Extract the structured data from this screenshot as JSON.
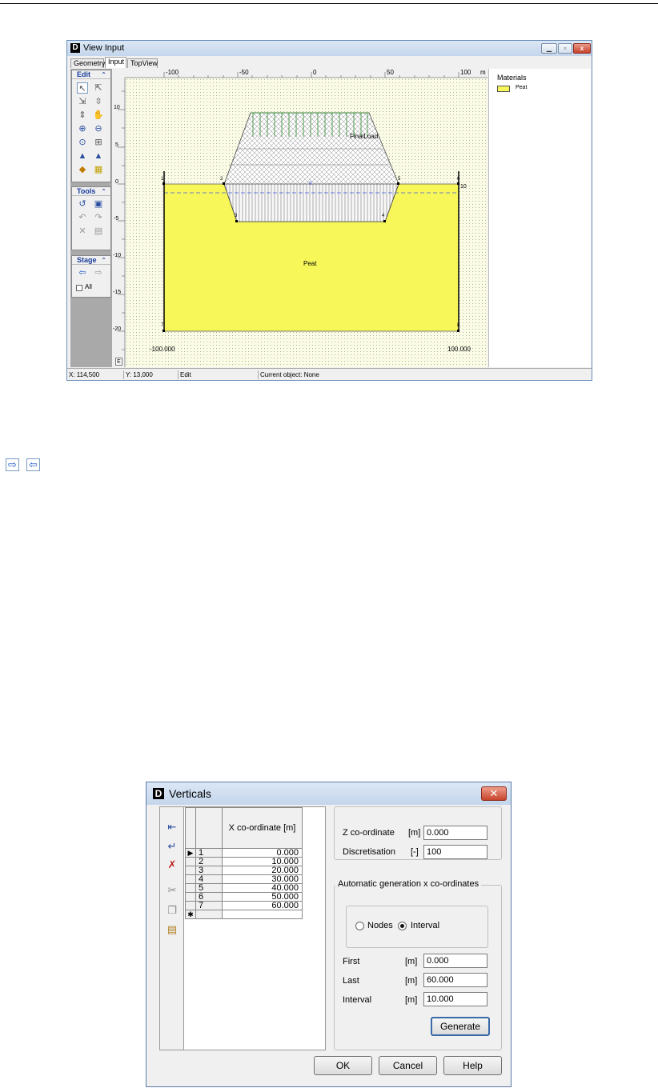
{
  "view_input": {
    "title": "View Input",
    "tabs": [
      "Geometry",
      "Input",
      "TopView"
    ],
    "panels": {
      "edit": "Edit",
      "tools": "Tools",
      "stage": "Stage",
      "all_label": "All"
    },
    "ruler": {
      "x_ticks": [
        "-100",
        "-50",
        "0",
        "50",
        "100",
        "m"
      ],
      "y_ticks": [
        "10",
        "5",
        "0",
        "-5",
        "-10",
        "-15",
        "-20"
      ],
      "corner": "E"
    },
    "drawing": {
      "load_label": "FinalLoad",
      "material_label": "Peat",
      "x_left_label": "-100.000",
      "x_right_label": "100.000",
      "points": [
        "1",
        "2",
        "3",
        "4",
        "5",
        "6",
        "7",
        "8",
        "9",
        "10"
      ]
    },
    "materials": {
      "title": "Materials",
      "items": [
        {
          "name": "Peat",
          "color": "#f7f75a"
        }
      ]
    },
    "status": {
      "x": "X: 114,500",
      "y": "Y: 13,000",
      "mode": "Edit",
      "object": "Current object: None"
    }
  },
  "verticals": {
    "title": "Verticals",
    "close_symbol": "✕",
    "column_header": "X co-ordinate [m]",
    "rows": [
      {
        "n": "1",
        "x": "0.000"
      },
      {
        "n": "2",
        "x": "10.000"
      },
      {
        "n": "3",
        "x": "20.000"
      },
      {
        "n": "4",
        "x": "30.000"
      },
      {
        "n": "5",
        "x": "40.000"
      },
      {
        "n": "6",
        "x": "50.000"
      },
      {
        "n": "7",
        "x": "60.000"
      }
    ],
    "z_coordinate": {
      "label": "Z co-ordinate",
      "unit": "[m]",
      "value": "0.000"
    },
    "discretisation": {
      "label": "Discretisation",
      "unit": "[-]",
      "value": "100"
    },
    "auto_group": "Automatic generation x co-ordinates",
    "radio": {
      "nodes": "Nodes",
      "interval": "Interval",
      "selected": "Interval"
    },
    "first": {
      "label": "First",
      "unit": "[m]",
      "value": "0.000"
    },
    "last": {
      "label": "Last",
      "unit": "[m]",
      "value": "60.000"
    },
    "interval": {
      "label": "Interval",
      "unit": "[m]",
      "value": "10.000"
    },
    "buttons": {
      "generate": "Generate",
      "ok": "OK",
      "cancel": "Cancel",
      "help": "Help"
    }
  }
}
